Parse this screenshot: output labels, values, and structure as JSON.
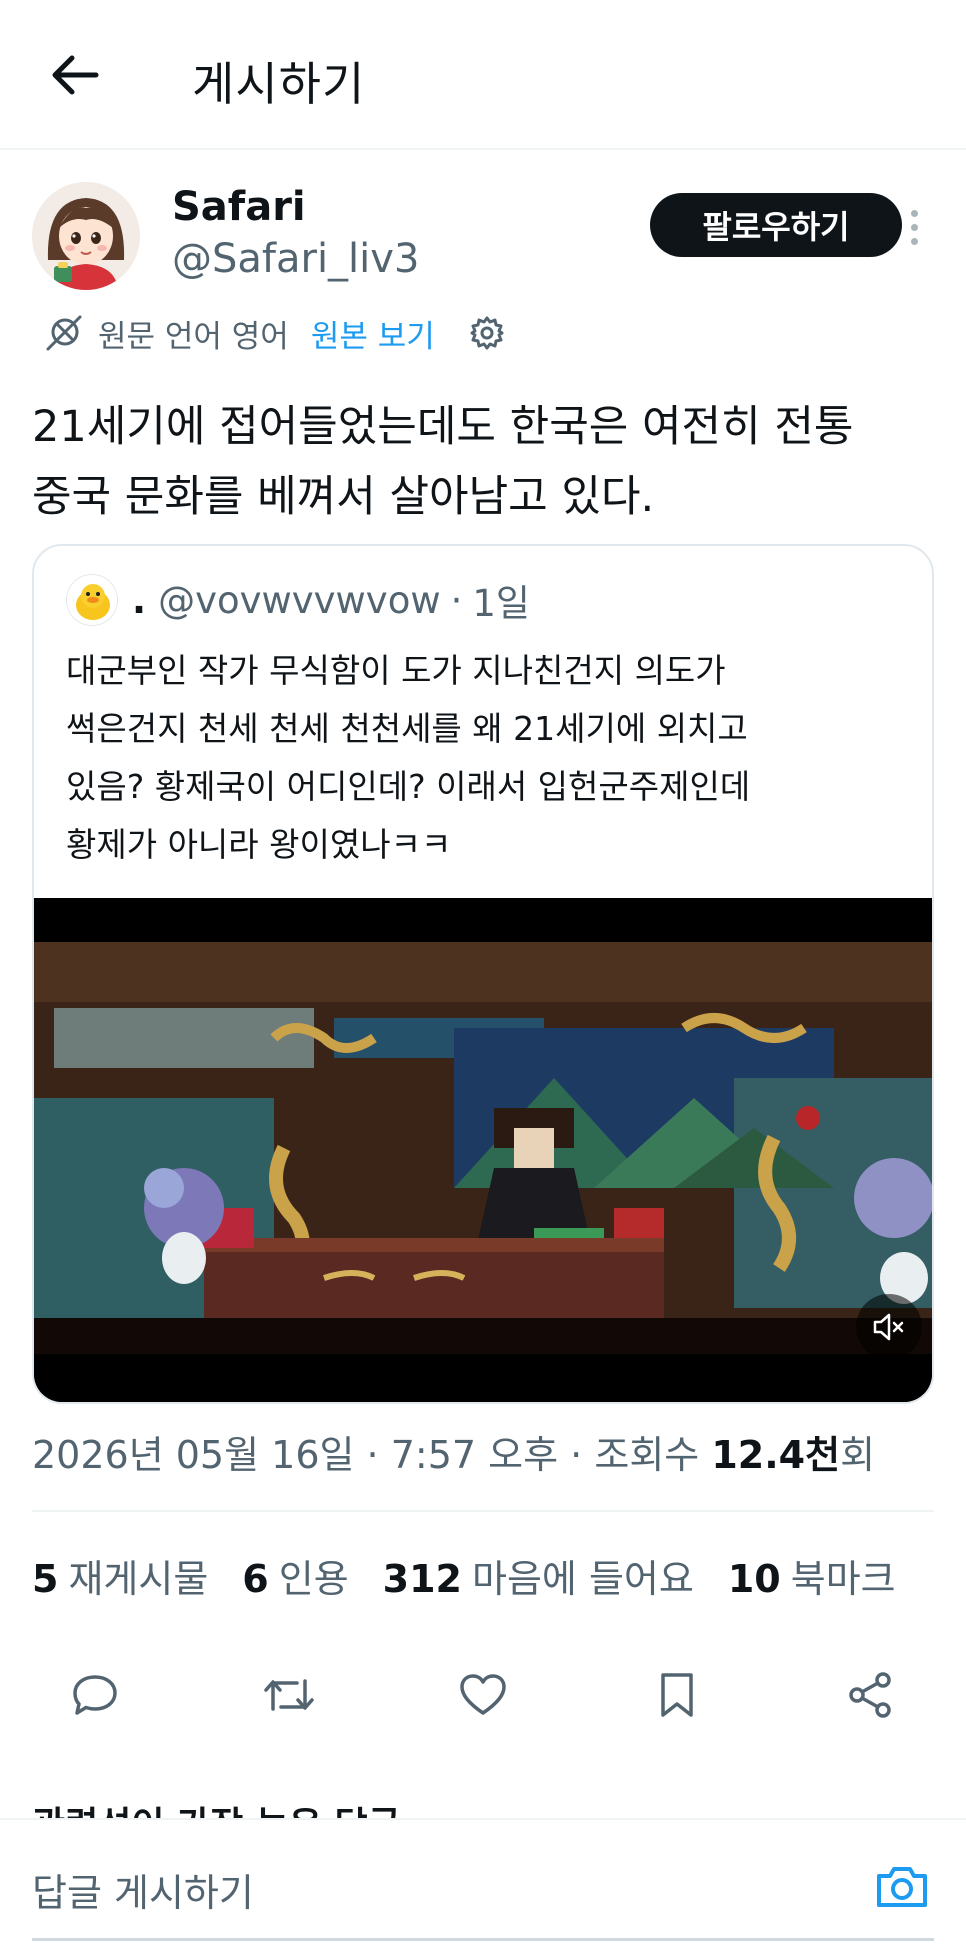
{
  "header": {
    "title": "게시하기",
    "back_icon": "arrow-left-icon"
  },
  "author": {
    "name": "Safari",
    "handle": "@Safari_liv3",
    "follow_label": "팔로우하기"
  },
  "translation": {
    "original_lang": "원문 언어 영어",
    "show_original": "원본 보기"
  },
  "tweet": {
    "text_line1": "21세기에 접어들었는데도 한국은 여전히 전통",
    "text_line2": "중국 문화를 베껴서 살아남고 있다."
  },
  "quote": {
    "dot": ".",
    "handle": "@vovwvvwvow",
    "separator": "·",
    "time": "1일",
    "lines": [
      "대군부인 작가 무식함이 도가 지나친건지 의도가",
      "썩은건지 천세 천세 천천세를 왜 21세기에 외치고",
      "있음? 황제국이 어디인데? 이래서 입헌군주제인데",
      "황제가 아니라 왕이였나ㅋㅋ"
    ]
  },
  "meta": {
    "date": "2026년 05월 16일",
    "sep1": "·",
    "time": "7:57 오후",
    "sep2": "·",
    "views_label": "조회수",
    "views_count": "12.4천",
    "views_suffix": "회"
  },
  "stats": [
    {
      "count": "5",
      "label": "재게시물"
    },
    {
      "count": "6",
      "label": "인용"
    },
    {
      "count": "312",
      "label": "마음에 들어요"
    },
    {
      "count": "10",
      "label": "북마크"
    }
  ],
  "related_label": "관련성이 가장 높은 답글",
  "reply": {
    "placeholder": "답글 게시하기"
  },
  "colors": {
    "accent": "#1d9bf0",
    "text": "#0f1419",
    "muted": "#536471",
    "button_bg": "#0f1419"
  }
}
